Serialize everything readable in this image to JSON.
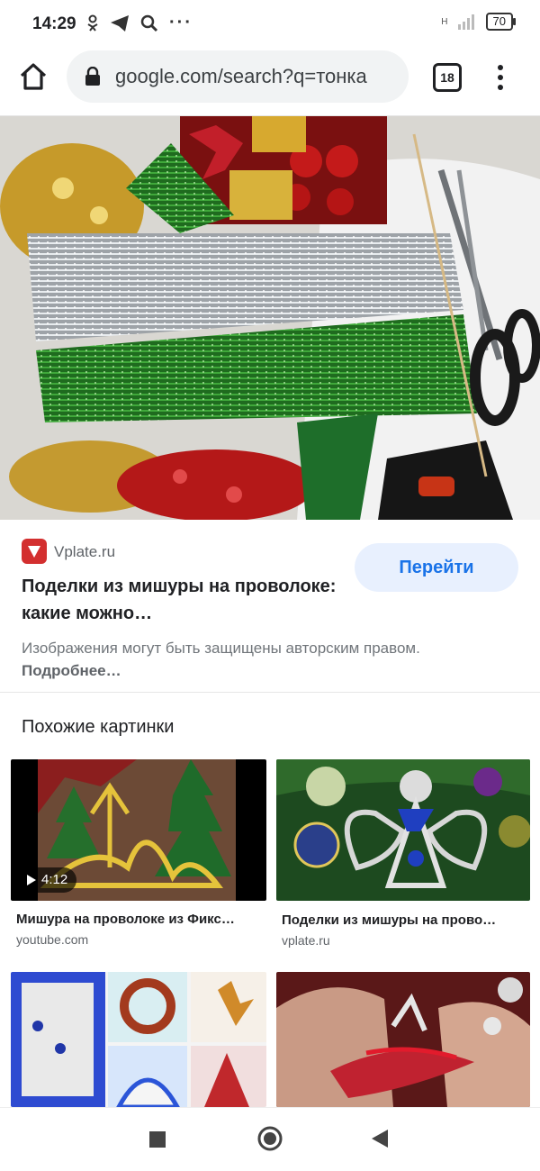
{
  "status": {
    "time": "14:29",
    "network": "H",
    "battery": "70"
  },
  "browser": {
    "url": "google.com/search?q=тонка",
    "tab_count": "18"
  },
  "result": {
    "source": "Vplate.ru",
    "goto_label": "Перейти",
    "title": "Поделки из мишуры на проволоке: какие можно…",
    "copyright_text": "Изображения могут быть защищены авторским правом.",
    "more_link": "Подробнее…"
  },
  "similar": {
    "heading": "Похожие картинки",
    "items": [
      {
        "caption": "Мишура на проволоке из Фикс…",
        "source": "youtube.com",
        "duration": "4:12"
      },
      {
        "caption": "Поделки из мишуры на прово…",
        "source": "vplate.ru"
      }
    ]
  },
  "colors": {
    "accent": "#1a73e8",
    "goto_bg": "#e8f0fe",
    "favicon": "#d32f2f"
  }
}
